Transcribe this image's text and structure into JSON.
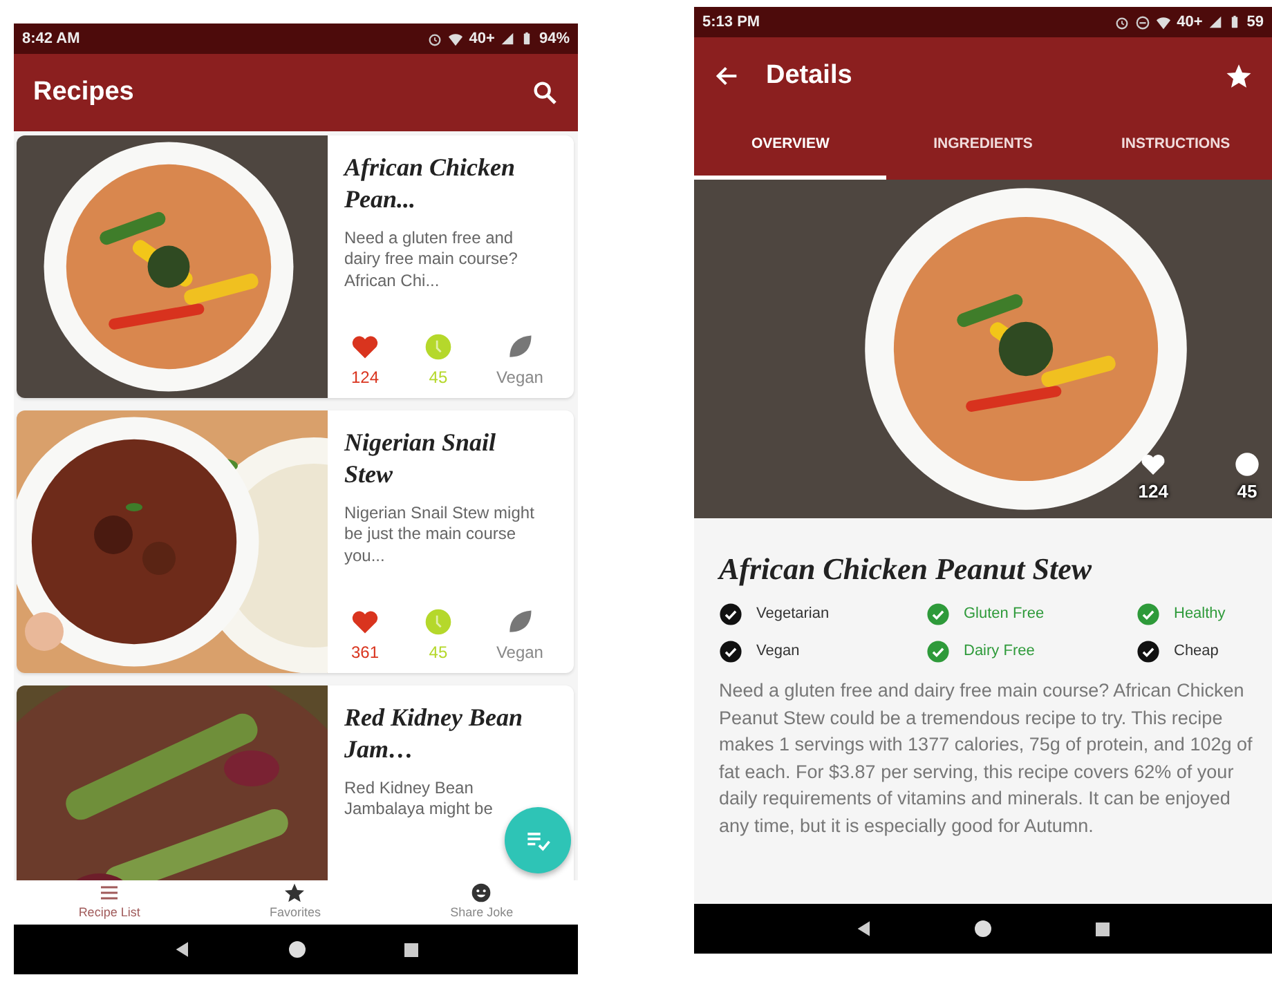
{
  "list_screen": {
    "status_bar": {
      "time": "8:42 AM",
      "network": "40+",
      "battery": "94%"
    },
    "app_bar": {
      "title": "Recipes"
    },
    "recipes": [
      {
        "title": "African Chicken Pean...",
        "description": "Need a gluten free and dairy free main course? African Chi...",
        "likes": "124",
        "minutes": "45",
        "diet": "Vegan",
        "kind": "picture"
      },
      {
        "title": "Nigerian Snail Stew",
        "description": "Nigerian Snail Stew might be just the main course you...",
        "likes": "361",
        "minutes": "45",
        "diet": "Vegan",
        "kind": "picture"
      },
      {
        "title": "Red Kidney Bean Jam…",
        "description": "Red Kidney Bean Jambalaya might be",
        "kind": "picture"
      }
    ],
    "bottom_nav": [
      {
        "label": "Recipe List",
        "kind": "list",
        "selected": true
      },
      {
        "label": "Favorites",
        "kind": "star",
        "selected": false
      },
      {
        "label": "Share Joke",
        "kind": "smile",
        "selected": false
      }
    ]
  },
  "detail_screen": {
    "status_bar": {
      "time": "5:13 PM",
      "network": "40+",
      "battery": "59"
    },
    "app_bar": {
      "title": "Details"
    },
    "tabs": [
      {
        "label": "OVERVIEW",
        "selected": true
      },
      {
        "label": "INGREDIENTS",
        "selected": false
      },
      {
        "label": "INSTRUCTIONS",
        "selected": false
      }
    ],
    "likes": "124",
    "minutes": "45",
    "title": "African Chicken Peanut Stew",
    "tags": [
      {
        "label": "Vegetarian",
        "checked": false
      },
      {
        "label": "Gluten Free",
        "checked": true
      },
      {
        "label": "Healthy",
        "checked": true
      },
      {
        "label": "Vegan",
        "checked": false
      },
      {
        "label": "Dairy Free",
        "checked": true
      },
      {
        "label": "Cheap",
        "checked": false
      }
    ],
    "summary": "Need a gluten free and dairy free main course? African Chicken Peanut Stew could be a tremendous recipe to try. This recipe makes 1 servings with 1377 calories, 75g of protein, and 102g of fat each. For $3.87 per serving, this recipe covers 62% of your daily requirements of vitamins and minerals. It can be enjoyed any time, but it is especially good for Autumn."
  }
}
